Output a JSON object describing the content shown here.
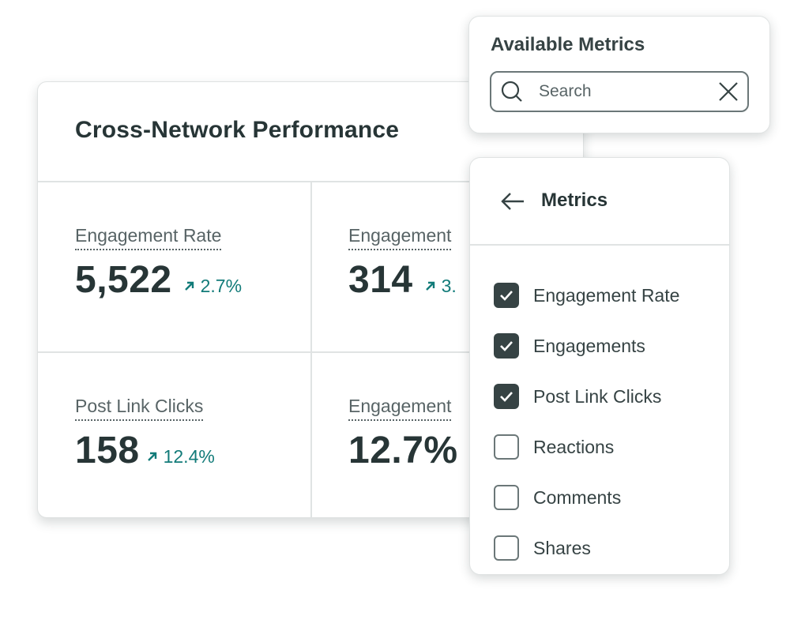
{
  "card": {
    "title": "Cross-Network Performance",
    "metrics": [
      {
        "label": "Engagement Rate",
        "value": "5,522",
        "change": "2.7%",
        "trend": "up"
      },
      {
        "label": "Engagement",
        "value": "314",
        "change": "3.",
        "trend": "up"
      },
      {
        "label": "Post Link Clicks",
        "value": "158",
        "change": "12.4%",
        "trend": "up"
      },
      {
        "label": "Engagement",
        "value": "12.7%",
        "change": null,
        "trend": null
      }
    ],
    "colors": {
      "positive_change": "#127b79",
      "text": "#273536"
    }
  },
  "available_metrics": {
    "title": "Available Metrics",
    "search": {
      "placeholder": "Search",
      "value": ""
    },
    "icons": {
      "search": "search-icon",
      "clear": "close-icon"
    }
  },
  "metrics_menu": {
    "title": "Metrics",
    "back_icon": "arrow-left-icon",
    "items": [
      {
        "label": "Engagement Rate",
        "checked": true
      },
      {
        "label": "Engagements",
        "checked": true
      },
      {
        "label": "Post Link Clicks",
        "checked": true
      },
      {
        "label": "Reactions",
        "checked": false
      },
      {
        "label": "Comments",
        "checked": false
      },
      {
        "label": "Shares",
        "checked": false
      }
    ]
  }
}
